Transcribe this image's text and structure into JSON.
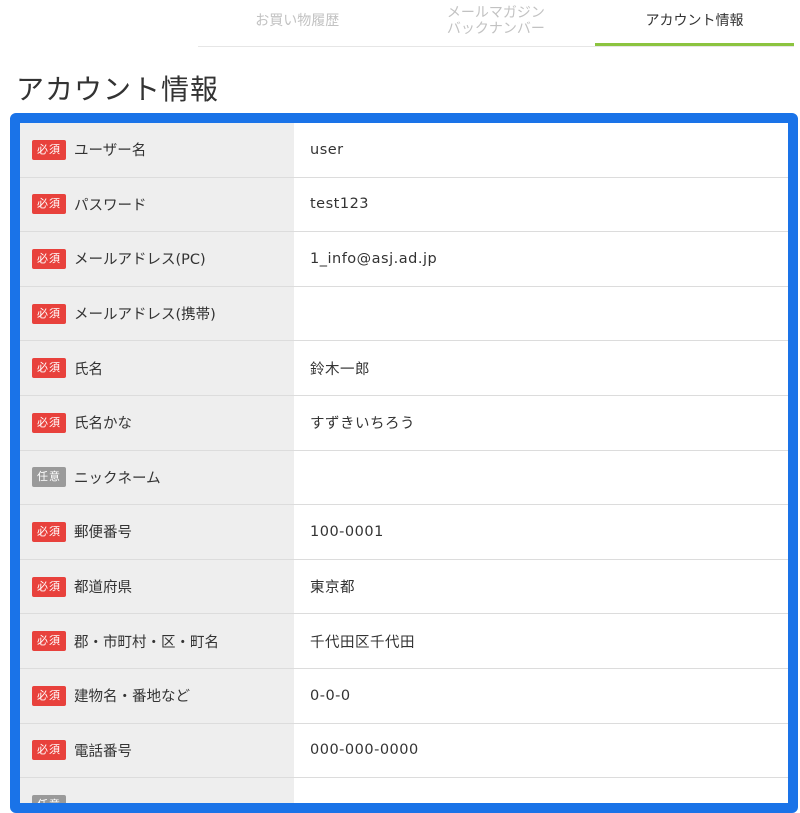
{
  "tabs": [
    {
      "label": "お買い物履歴",
      "active": false
    },
    {
      "label": "メールマガジン\nバックナンバー",
      "active": false
    },
    {
      "label": "アカウント情報",
      "active": true
    }
  ],
  "page_title": "アカウント情報",
  "badges": {
    "required": "必須",
    "optional": "任意"
  },
  "fields": [
    {
      "badge": "必須",
      "label": "ユーザー名",
      "value": "user"
    },
    {
      "badge": "必須",
      "label": "パスワード",
      "value": "test123"
    },
    {
      "badge": "必須",
      "label": "メールアドレス(PC)",
      "value": "1_info@asj.ad.jp"
    },
    {
      "badge": "必須",
      "label": "メールアドレス(携帯)",
      "value": ""
    },
    {
      "badge": "必須",
      "label": "氏名",
      "value": "鈴木一郎"
    },
    {
      "badge": "必須",
      "label": "氏名かな",
      "value": "すずきいちろう"
    },
    {
      "badge": "任意",
      "label": "ニックネーム",
      "value": ""
    },
    {
      "badge": "必須",
      "label": "郵便番号",
      "value": "100-0001"
    },
    {
      "badge": "必須",
      "label": "都道府県",
      "value": "東京都"
    },
    {
      "badge": "必須",
      "label": "郡・市町村・区・町名",
      "value": "千代田区千代田"
    },
    {
      "badge": "必須",
      "label": "建物名・番地など",
      "value": "0-0-0"
    },
    {
      "badge": "必須",
      "label": "電話番号",
      "value": "000-000-0000"
    },
    {
      "badge": "任意",
      "label": "",
      "value": ""
    }
  ],
  "colors": {
    "accent_border": "#1a73e8",
    "active_tab_underline": "#8cc43f",
    "required_badge": "#e8413c",
    "optional_badge": "#9a9a9a",
    "label_bg": "#eeeeee"
  }
}
